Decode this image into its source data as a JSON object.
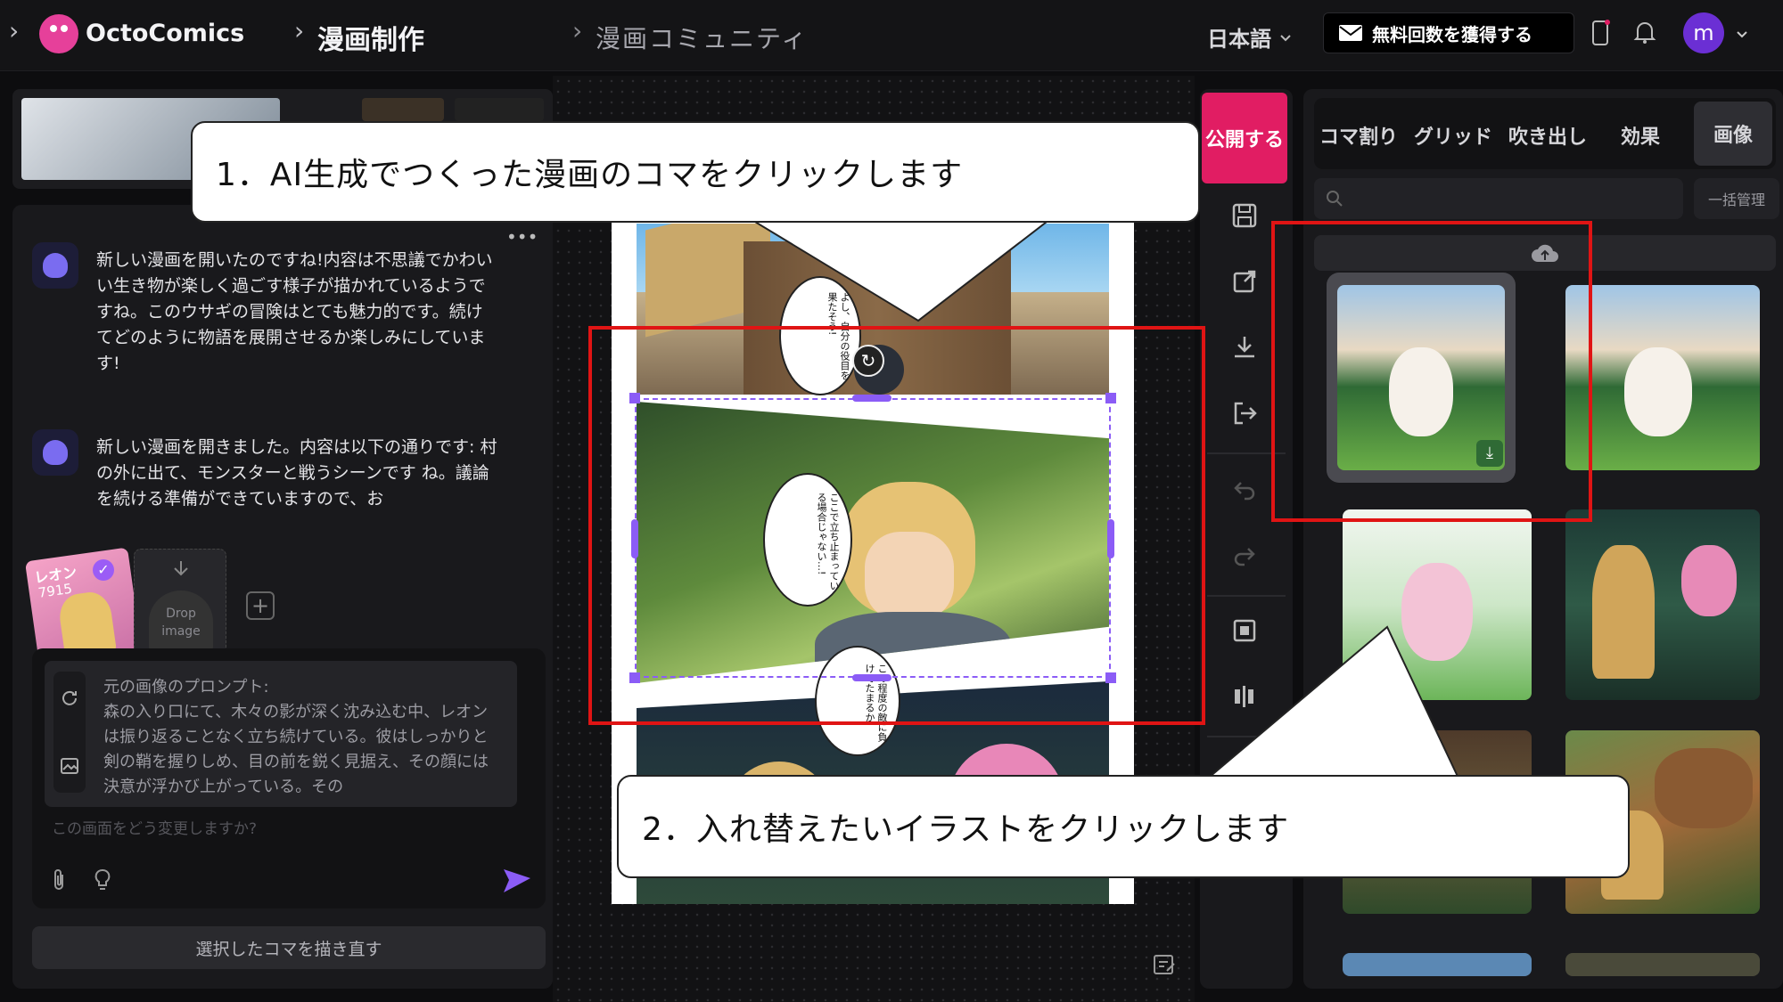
{
  "topbar": {
    "brand": "OctoComics",
    "nav_main": "漫画制作",
    "nav_community": "漫画コミュニティ",
    "language": "日本語",
    "promo_label": "無料回数を獲得する",
    "avatar_letter": "m"
  },
  "chat": {
    "messages": [
      "新しい漫画を開いたのですね!内容は不思議でかわいい生き物が楽しく過ごす様子が描かれているようですね。このウサギの冒険はとても魅力的です。続けてどのように物語を展開させるか楽しみにしています!",
      "新しい漫画を開きました。内容は以下の通りです: 村の外に出て、モンスターと戦うシーンです ね。議論を続ける準備ができていますので、お"
    ],
    "card_name": "レオン",
    "card_number": "7915",
    "drop_label": "Drop image",
    "prompt_heading": "元の画像のプロンプト:",
    "prompt_text": "森の入り口にて、木々の影が深く沈み込む中、レオンは振り返ることなく立ち続けている。彼はしっかりと剣の鞘を握りしめ、目の前を鋭く見据え、その顔には決意が浮かび上がっている。その",
    "input_placeholder": "この画面をどう変更しますか?",
    "redraw_button": "選択したコマを描き直す"
  },
  "toolbar": {
    "publish_label": "公開する"
  },
  "right_panel": {
    "tabs": [
      "コマ割り",
      "グリッド",
      "吹き出し",
      "効果",
      "画像"
    ],
    "active_tab": "画像",
    "bulk_manage": "一括管理"
  },
  "manga": {
    "bubble_1": "よし、自分の役目を果たそう!",
    "bubble_2": "ここで立ち止まっている場合じゃない…!",
    "bubble_3": "この程度の敵に負けてたまるか!"
  },
  "callouts": {
    "step1": "1．AI生成でつくった漫画のコマをクリックします",
    "step2": "2．入れ替えたいイラストをクリックします"
  },
  "colors": {
    "accent_pink": "#e11d63",
    "highlight_red": "#e01414",
    "selection_purple": "#8b5cf6"
  }
}
